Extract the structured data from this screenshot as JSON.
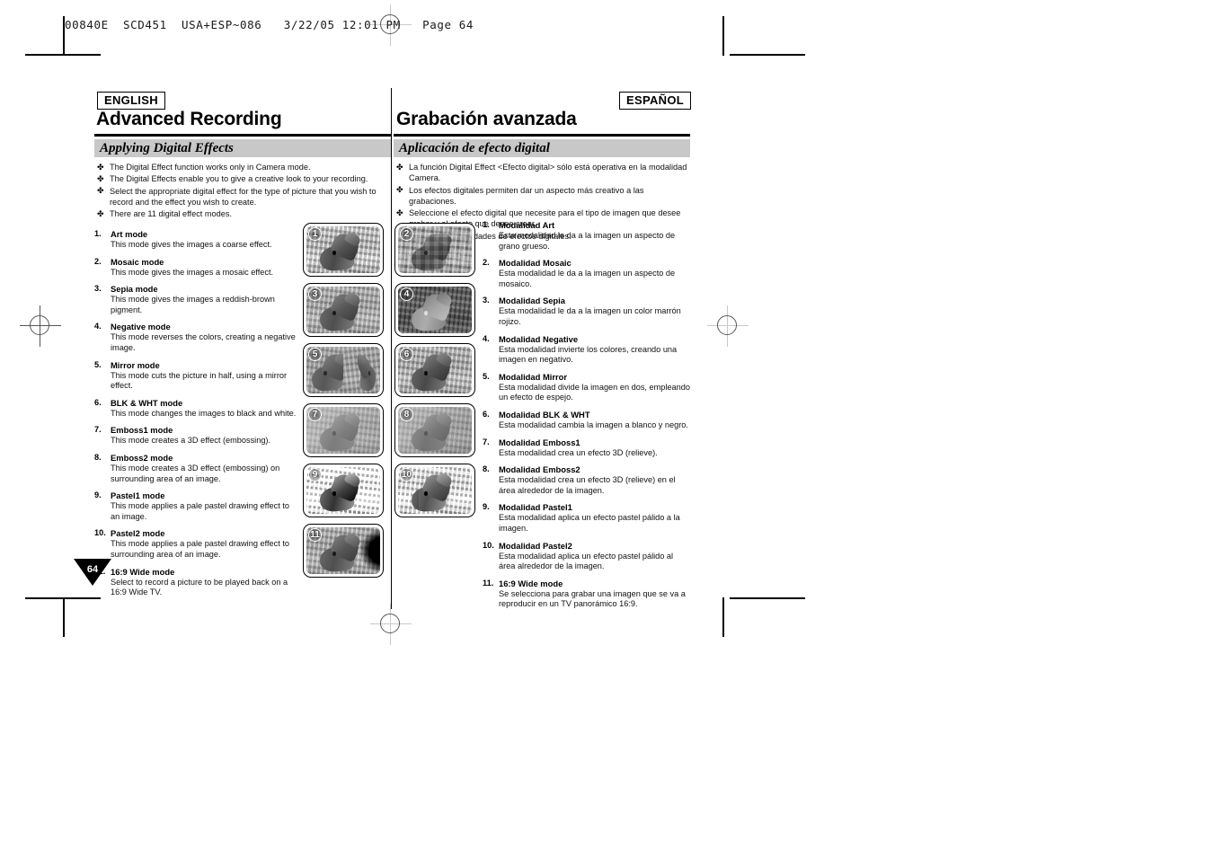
{
  "slug": "00840E  SCD451  USA+ESP~086   3/22/05 12:01 PM   Page 64",
  "page_number": "64",
  "english": {
    "lang_tag": "ENGLISH",
    "chapter_title": "Advanced Recording",
    "section_title": "Applying Digital Effects",
    "intro_bullets": [
      "The Digital Effect function works only in Camera mode.",
      "The Digital Effects enable you to give a creative look to your recording.",
      "Select the appropriate digital effect for the type of picture that you wish to record and the effect you wish to create.",
      "There are 11 digital effect modes."
    ],
    "modes": [
      {
        "num": "1.",
        "name": "Art mode",
        "desc": "This mode gives the images a coarse effect."
      },
      {
        "num": "2.",
        "name": "Mosaic mode",
        "desc": "This mode gives the images a mosaic effect."
      },
      {
        "num": "3.",
        "name": "Sepia mode",
        "desc": "This mode gives the images a reddish-brown pigment."
      },
      {
        "num": "4.",
        "name": "Negative mode",
        "desc": "This mode reverses the colors, creating a negative image."
      },
      {
        "num": "5.",
        "name": "Mirror mode",
        "desc": "This mode cuts the picture in half, using a mirror effect."
      },
      {
        "num": "6.",
        "name": "BLK & WHT mode",
        "desc": "This mode changes the images to black and white."
      },
      {
        "num": "7.",
        "name": "Emboss1 mode",
        "desc": "This mode creates a 3D effect (embossing)."
      },
      {
        "num": "8.",
        "name": "Emboss2 mode",
        "desc": "This mode creates a 3D effect (embossing) on surrounding area of an image."
      },
      {
        "num": "9.",
        "name": "Pastel1 mode",
        "desc": "This mode applies a pale pastel drawing effect to an image."
      },
      {
        "num": "10.",
        "name": "Pastel2 mode",
        "desc": "This mode applies a pale pastel drawing effect to surrounding area of an image."
      },
      {
        "num": "11.",
        "name": "16:9 Wide mode",
        "desc": "Select to record a picture to be played back on a 16:9 Wide TV."
      }
    ]
  },
  "spanish": {
    "lang_tag": "ESPAÑOL",
    "chapter_title": "Grabación avanzada",
    "section_title": "Aplicación de efecto digital",
    "intro_bullets": [
      "La función Digital Effect <Efecto digital> sólo está operativa en la modalidad Camera.",
      "Los efectos digitales permiten dar un aspecto más creativo a las grabaciones.",
      "Seleccione el efecto digital que necesite para el tipo de imagen que desee grabar y el efecto que desee crear.",
      "Existen 11 modalidades de efectos digitales."
    ],
    "modes": [
      {
        "num": "1.",
        "name": "Modalidad Art",
        "desc": "Esta modalidad le da a la imagen un aspecto de grano grueso."
      },
      {
        "num": "2.",
        "name": "Modalidad Mosaic",
        "desc": "Esta modalidad le da a la imagen un aspecto de mosaico."
      },
      {
        "num": "3.",
        "name": "Modalidad Sepia",
        "desc": "Esta modalidad le da a la imagen un color marrón rojizo."
      },
      {
        "num": "4.",
        "name": "Modalidad Negative",
        "desc": "Esta modalidad invierte los colores, creando una imagen en negativo."
      },
      {
        "num": "5.",
        "name": "Modalidad Mirror",
        "desc": "Esta modalidad divide la imagen en dos, empleando un efecto de espejo."
      },
      {
        "num": "6.",
        "name": "Modalidad BLK & WHT",
        "desc": "Esta modalidad cambia la imagen a blanco y negro."
      },
      {
        "num": "7.",
        "name": "Modalidad Emboss1",
        "desc": "Esta modalidad crea un efecto 3D (relieve)."
      },
      {
        "num": "8.",
        "name": "Modalidad Emboss2",
        "desc": "Esta modalidad crea un efecto 3D (relieve) en el área alrededor de la imagen."
      },
      {
        "num": "9.",
        "name": "Modalidad Pastel1",
        "desc": "Esta modalidad aplica un efecto pastel pálido a la imagen."
      },
      {
        "num": "10.",
        "name": "Modalidad Pastel2",
        "desc": "Esta modalidad aplica un efecto pastel pálido al área alrededor de la imagen."
      },
      {
        "num": "11.",
        "name": "16:9 Wide mode",
        "desc": "Se selecciona para grabar una imagen que se va a reproducir en un TV panorámico 16:9."
      }
    ]
  },
  "thumbnails": [
    {
      "badge": "1"
    },
    {
      "badge": "2"
    },
    {
      "badge": "3"
    },
    {
      "badge": "4"
    },
    {
      "badge": "5"
    },
    {
      "badge": "6"
    },
    {
      "badge": "7"
    },
    {
      "badge": "8"
    },
    {
      "badge": "9"
    },
    {
      "badge": "10"
    },
    {
      "badge": "11"
    }
  ],
  "colors": {
    "section_bar": "#c8c8c8",
    "rule": "#000000",
    "text": "#111111"
  }
}
